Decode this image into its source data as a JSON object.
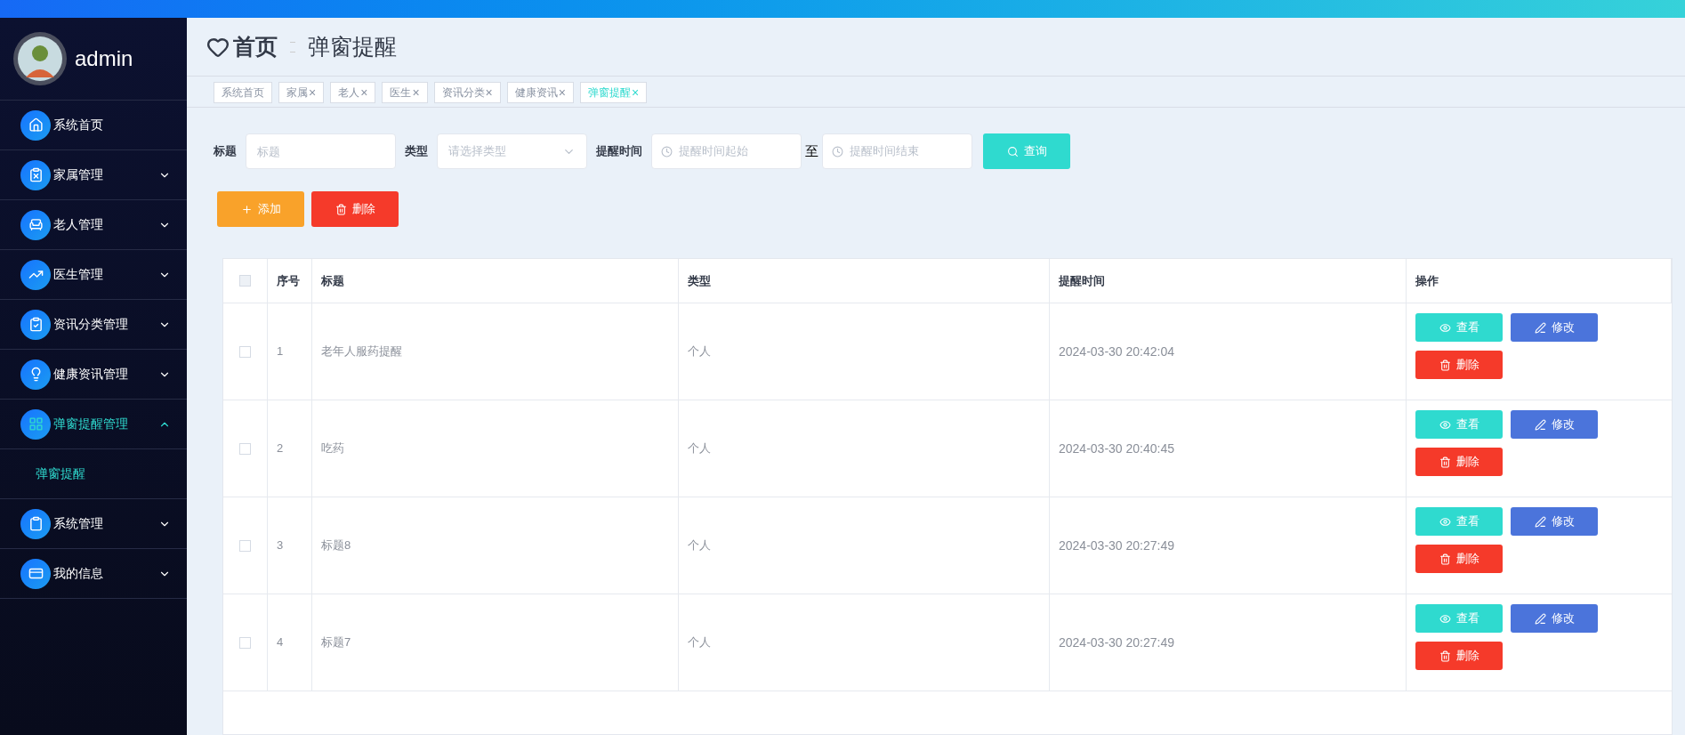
{
  "sidebar": {
    "user": {
      "name": "admin"
    },
    "menu": [
      {
        "label": "系统首页",
        "selected": false
      },
      {
        "label": "家属管理",
        "expanded": false,
        "selected": false
      },
      {
        "label": "老人管理",
        "expanded": false,
        "selected": false
      },
      {
        "label": "医生管理",
        "expanded": false,
        "selected": false
      },
      {
        "label": "资讯分类管理",
        "expanded": false,
        "selected": false
      },
      {
        "label": "健康资讯管理",
        "expanded": false,
        "selected": false
      },
      {
        "label": "弹窗提醒管理",
        "expanded": true,
        "selected": true,
        "children": [
          {
            "label": "弹窗提醒",
            "selected": true
          }
        ]
      },
      {
        "label": "系统管理",
        "expanded": false,
        "selected": false
      },
      {
        "label": "我的信息",
        "expanded": false,
        "selected": false
      }
    ]
  },
  "breadcrumb": {
    "home": "首页",
    "current": "弹窗提醒"
  },
  "tabs": [
    {
      "label": "系统首页",
      "selected": false
    },
    {
      "label": "家属",
      "close": "×",
      "selected": false
    },
    {
      "label": "老人",
      "close": "×",
      "selected": false
    },
    {
      "label": "医生",
      "close": "×",
      "selected": false
    },
    {
      "label": "资讯分类",
      "close": "×",
      "selected": false
    },
    {
      "label": "健康资讯",
      "close": "×",
      "selected": false
    },
    {
      "label": "弹窗提醒",
      "close": "×",
      "selected": true
    }
  ],
  "search": {
    "fields": [
      {
        "label": "标题",
        "kind": "text",
        "placeholder": "标题"
      },
      {
        "label": "类型",
        "kind": "select",
        "placeholder": "请选择类型"
      },
      {
        "label": "提醒时间",
        "kind": "daterange",
        "start_placeholder": "提醒时间起始",
        "separator": "至",
        "end_placeholder": "提醒时间结束"
      }
    ],
    "button": "查询"
  },
  "actions": [
    {
      "label": "添加",
      "kind": "add"
    },
    {
      "label": "删除",
      "kind": "delete"
    }
  ],
  "table": {
    "select_all": false,
    "columns": [
      "序号",
      "标题",
      "类型",
      "提醒时间",
      "操作"
    ],
    "rows": [
      {
        "checked": false,
        "cells": [
          "1",
          "老年人服药提醒",
          "个人",
          "2024-03-30 20:42:04"
        ],
        "actions": [
          {
            "label": "查看",
            "kind": "view"
          },
          {
            "label": "修改",
            "kind": "edit"
          },
          {
            "label": "删除",
            "kind": "delete"
          }
        ]
      },
      {
        "checked": false,
        "cells": [
          "2",
          "吃药",
          "个人",
          "2024-03-30 20:40:45"
        ],
        "actions": [
          {
            "label": "查看",
            "kind": "view"
          },
          {
            "label": "修改",
            "kind": "edit"
          },
          {
            "label": "删除",
            "kind": "delete"
          }
        ]
      },
      {
        "checked": false,
        "cells": [
          "3",
          "标题8",
          "个人",
          "2024-03-30 20:27:49"
        ],
        "actions": [
          {
            "label": "查看",
            "kind": "view"
          },
          {
            "label": "修改",
            "kind": "edit"
          },
          {
            "label": "删除",
            "kind": "delete"
          }
        ]
      },
      {
        "checked": false,
        "cells": [
          "4",
          "标题7",
          "个人",
          "2024-03-30 20:27:49"
        ],
        "actions": [
          {
            "label": "查看",
            "kind": "view"
          },
          {
            "label": "修改",
            "kind": "edit"
          },
          {
            "label": "删除",
            "kind": "delete"
          }
        ]
      }
    ]
  }
}
